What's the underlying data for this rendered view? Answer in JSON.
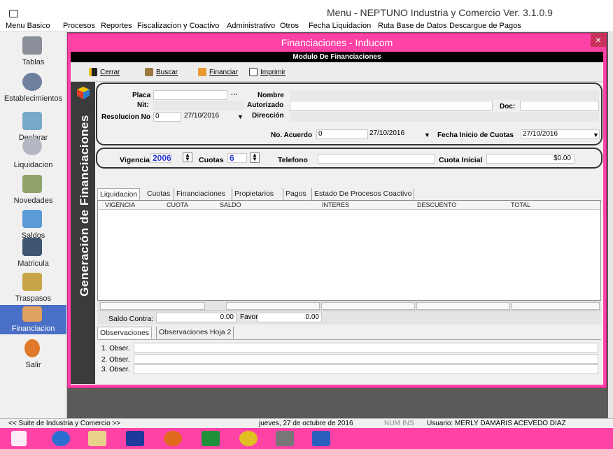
{
  "window": {
    "title": "Menu - NEPTUNO Industria y Comercio Ver. 3.1.0.9"
  },
  "menu": [
    "Menu Basico",
    "Procesos",
    "Reportes",
    "Fiscalizacion y Coactivo",
    "Administrativo",
    "Otros",
    "Fecha Liquidacion",
    "Ruta Base de Datos",
    "Descargue de Pagos"
  ],
  "sidebar": [
    {
      "label": "Tablas",
      "icon": "book-icon"
    },
    {
      "label": "Establecimientos",
      "icon": "gears-icon"
    },
    {
      "label": "Declarar",
      "icon": "folder-icon"
    },
    {
      "label": "Liquidacion",
      "icon": "gear-icon"
    },
    {
      "label": "Novedades",
      "icon": "drawer-icon"
    },
    {
      "label": "Saldos",
      "icon": "transfer-icon"
    },
    {
      "label": "Matricula",
      "icon": "notebook-icon"
    },
    {
      "label": "Traspasos",
      "icon": "edit-icon"
    },
    {
      "label": "Financiacion",
      "icon": "handshake-icon"
    },
    {
      "label": "Salir",
      "icon": "walk-icon"
    }
  ],
  "dialog": {
    "title": "Financiaciones - Inducom",
    "close": "×",
    "module_header": "Modulo De Financiaciones",
    "vertical_title": "Generación de Financiaciones",
    "toolbar": {
      "cerrar": "Cerrar",
      "buscar": "Buscar",
      "financiar": "Financiar",
      "imprimir": "Imprimir"
    },
    "form": {
      "placa_label": "Placa",
      "placa_value": "",
      "placa_btn": "···",
      "nombre_label": "Nombre",
      "nombre_value": "",
      "nit_label": "Nit:",
      "nit_value": "",
      "autorizado_label": "Autorizado",
      "autorizado_value": "",
      "doc_label": "Doc:",
      "doc_value": "",
      "resolucion_label": "Resolucion No",
      "resolucion_value": "0",
      "resolucion_date": "27/10/2016",
      "direccion_label": "Dirección",
      "direccion_value": "",
      "acuerdo_label": "No. Acuerdo",
      "acuerdo_value": "0",
      "acuerdo_date": "27/10/2016",
      "fecha_inicio_label": "Fecha Inicio de Cuotas",
      "fecha_inicio_value": "27/10/2016",
      "vigencia_label": "Vigencia",
      "vigencia_value": "2006",
      "cuotas_label": "Cuotas",
      "cuotas_value": "6",
      "telefono_label": "Telefono",
      "telefono_value": "",
      "cuota_inicial_label": "Cuota Inicial",
      "cuota_inicial_value": "$0.00"
    },
    "tabs": [
      "Liquidacion",
      "Cuotas",
      "Financiaciones",
      "Propietarios",
      "Pagos",
      "Estado De Procesos Coactivo"
    ],
    "columns": [
      "VIGENCIA",
      "CUOTA",
      "SALDO",
      "INTERES",
      "DESCUENTO",
      "TOTAL"
    ],
    "saldo_contra_label": "Saldo Contra:",
    "saldo_contra_value": "0.00",
    "favor_label": "Favor",
    "favor_value": "0.00",
    "obs_tabs": [
      "Observaciones",
      "Observaciones Hoja 2"
    ],
    "obs": [
      {
        "label": "1. Obser.",
        "value": ""
      },
      {
        "label": "2. Obser.",
        "value": ""
      },
      {
        "label": "3. Obser.",
        "value": ""
      }
    ]
  },
  "status": {
    "left": "<<  Suite de Industria y Comercio  >>",
    "date": "jueves, 27 de octubre de 2016",
    "num": "NUM",
    "ins": "INS",
    "user": "Usuario: MERLY DAMARIS ACEVEDO DIAZ"
  },
  "colors": {
    "accent": "#ff42a6",
    "dark": "#3b3b3b",
    "active": "#4a6fc6"
  }
}
